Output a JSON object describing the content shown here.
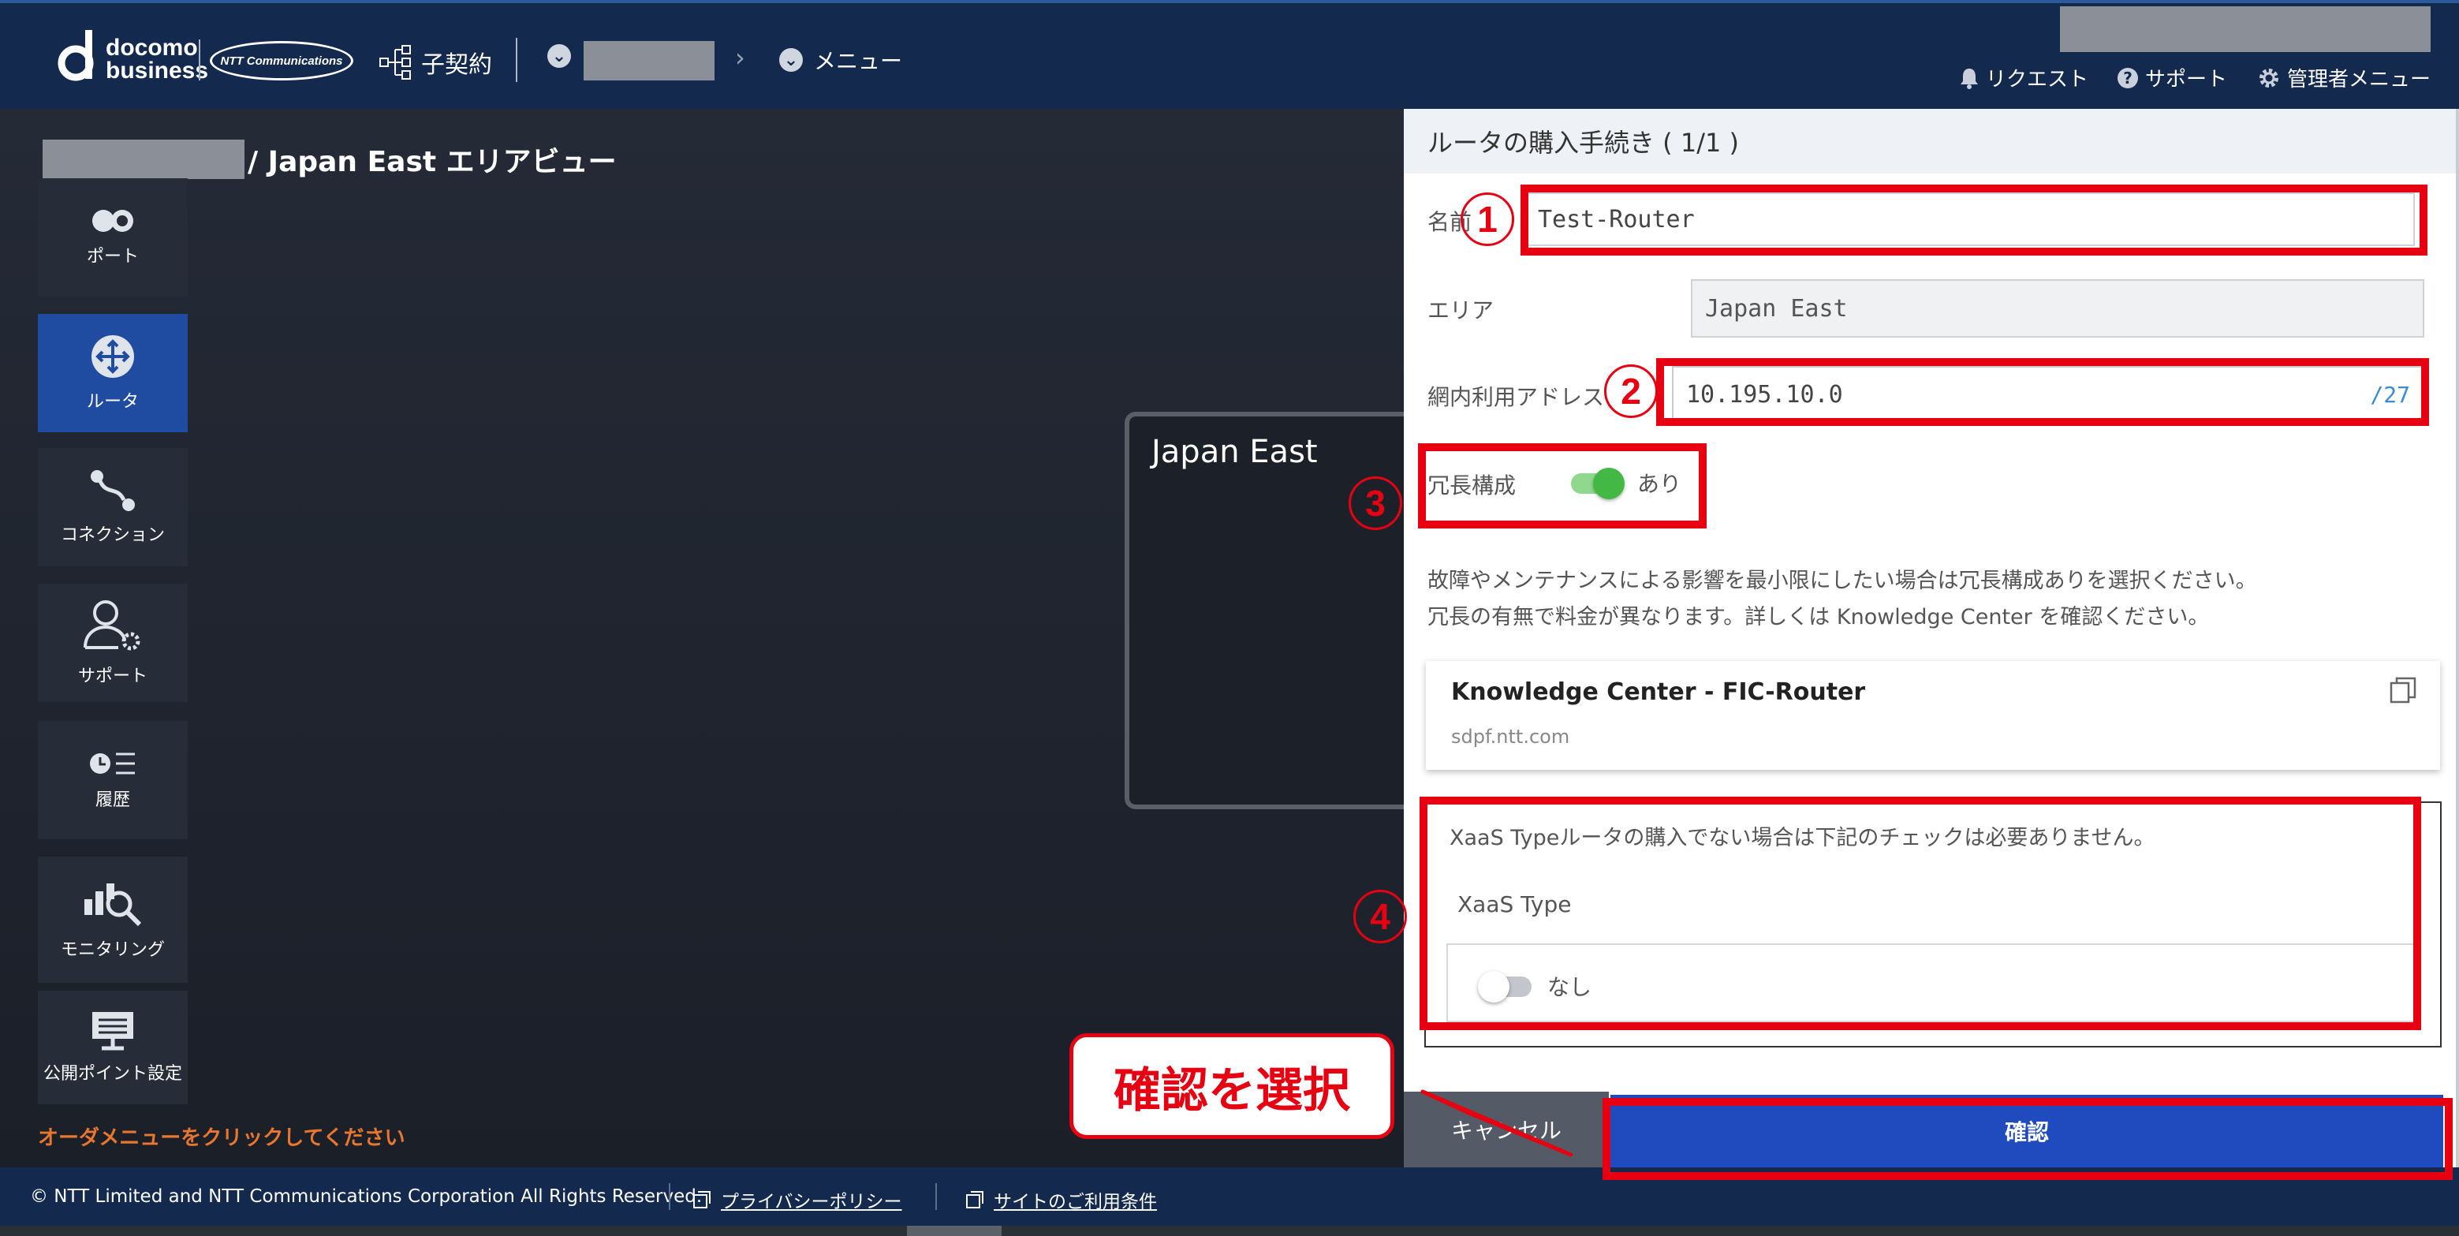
{
  "header": {
    "logo_brand": "docomo",
    "logo_sub": "business",
    "ntt_logo": "NTT Communications",
    "contract_label": "子契約",
    "breadcrumb_menu": "メニュー",
    "nav": {
      "request": "リクエスト",
      "support": "サポート",
      "admin_menu": "管理者メニュー"
    }
  },
  "page": {
    "title": "/ Japan East エリアビュー",
    "area_label": "Japan East",
    "order_message": "オーダメニューをクリックしてください"
  },
  "sidebar": {
    "items": [
      {
        "label": "ポート",
        "icon": "port-icon"
      },
      {
        "label": "ルータ",
        "icon": "router-icon",
        "active": true
      },
      {
        "label": "コネクション",
        "icon": "connection-icon"
      },
      {
        "label": "サポート",
        "icon": "support-user-icon"
      },
      {
        "label": "履歴",
        "icon": "history-icon"
      },
      {
        "label": "モニタリング",
        "icon": "monitoring-icon"
      },
      {
        "label": "公開ポイント設定",
        "icon": "public-point-icon"
      }
    ]
  },
  "panel": {
    "title": "ルータの購入手続き ( 1/1 )",
    "name_label": "名前",
    "name_value": "Test-Router",
    "area_label": "エリア",
    "area_value": "Japan East",
    "address_label": "網内利用アドレス",
    "address_value": "10.195.10.0",
    "address_suffix": "/27",
    "redundancy_label": "冗長構成",
    "redundancy_value": "あり",
    "help_line1": "故障やメンテナンスによる影響を最小限にしたい場合は冗長構成ありを選択ください。",
    "help_line2": "冗長の有無で料金が異なります。詳しくは Knowledge Center を確認ください。",
    "kc_title": "Knowledge Center - FIC-Router",
    "kc_url": "sdpf.ntt.com",
    "xaas_note": "XaaS Typeルータの購入でない場合は下記のチェックは必要ありません。",
    "xaas_label": "XaaS Type",
    "xaas_value": "なし",
    "cancel_label": "キャンセル",
    "confirm_label": "確認"
  },
  "annotations": {
    "n1": "1",
    "n2": "2",
    "n3": "3",
    "n4": "4",
    "callout": "確認を選択"
  },
  "footer": {
    "copyright": "© NTT Limited and NTT Communications Corporation All Rights Reserved.",
    "privacy": "プライバシーポリシー",
    "terms": "サイトのご利用条件"
  },
  "colors": {
    "header_bg": "#132a4e",
    "accent_blue": "#1f4bbf",
    "annotation_red": "#e60012",
    "toggle_on": "#44b844",
    "order_msg": "#e8762e"
  }
}
